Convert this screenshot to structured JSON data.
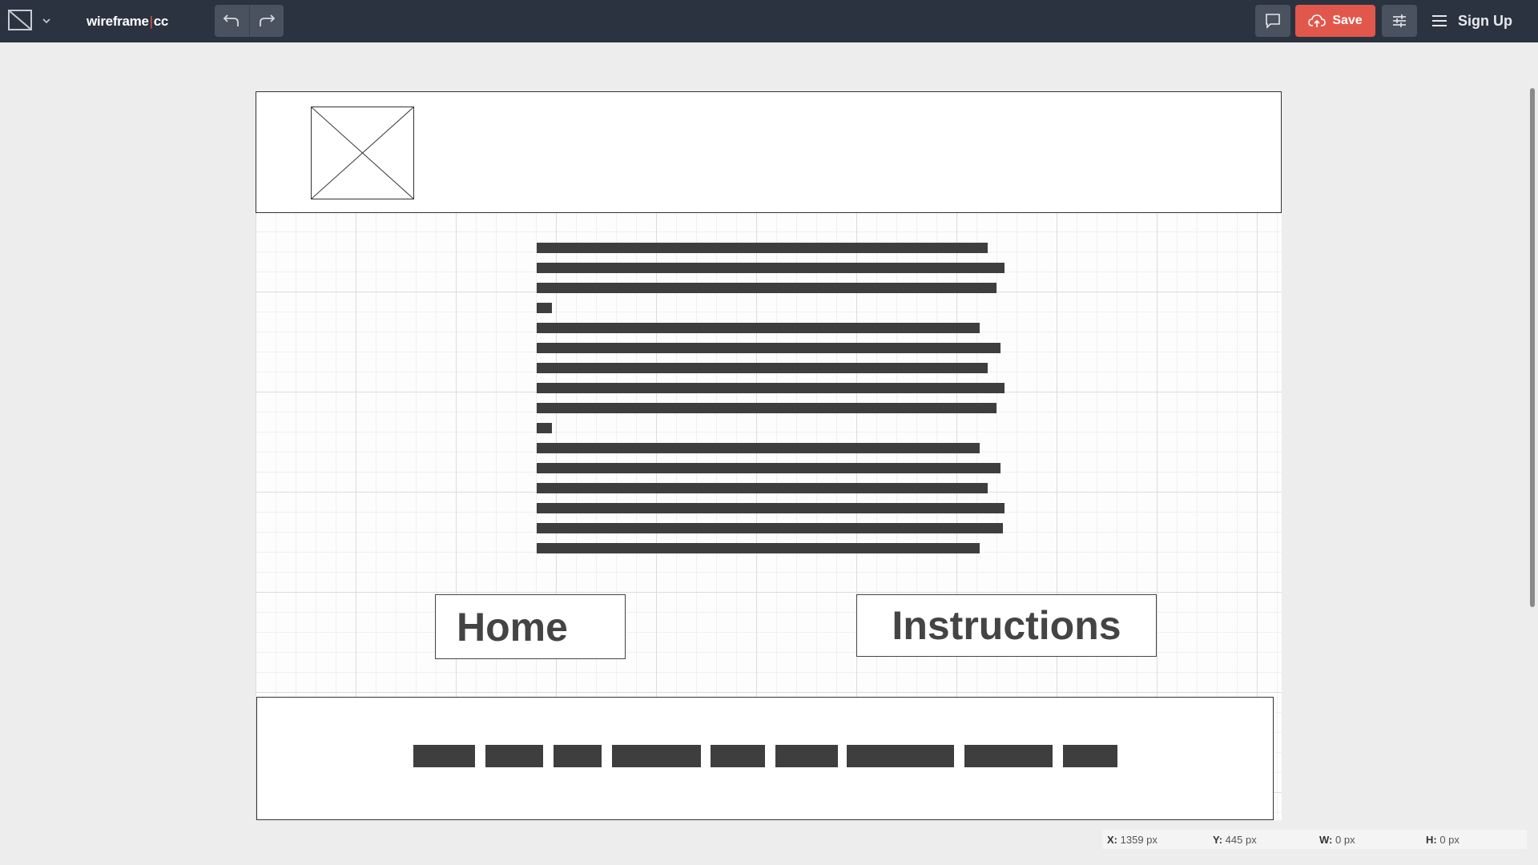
{
  "app": {
    "logo_left": "wireframe",
    "logo_sep": "|",
    "logo_right": "cc"
  },
  "toolbar": {
    "save_label": "Save",
    "signup_label": "Sign Up",
    "icons": {
      "stencil": "square-slash-icon",
      "undo": "undo-icon",
      "redo": "redo-icon",
      "comment": "comment-icon",
      "save": "cloud-upload-icon",
      "settings": "sliders-icon",
      "menu": "hamburger-icon"
    }
  },
  "canvas": {
    "home_button": "Home",
    "instructions_button": "Instructions"
  },
  "status": {
    "x_label": "X:",
    "x_value": "1359 px",
    "y_label": "Y:",
    "y_value": "445 px",
    "w_label": "W:",
    "w_value": "0 px",
    "h_label": "H:",
    "h_value": "0 px"
  },
  "colors": {
    "toolbar_bg": "#2b3340",
    "save_accent": "#e2574c",
    "wireframe_ink": "#3e3e3e"
  }
}
